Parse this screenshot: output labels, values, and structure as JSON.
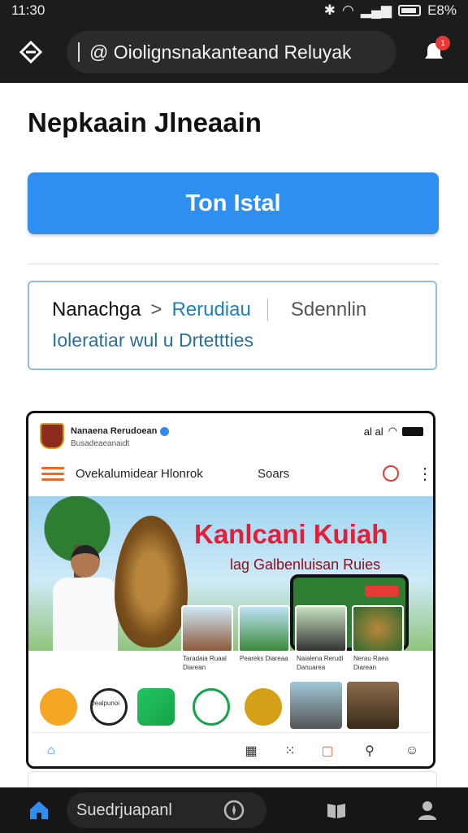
{
  "status": {
    "time": "11:30",
    "battery": "E8%"
  },
  "browser": {
    "url": "@ Oiolignsnakanteand Reluyak",
    "notification_count": "1"
  },
  "page": {
    "title": "Nepkaain Jlneaain",
    "install_label": "Ton Istal",
    "breadcrumb": {
      "home": "Nanachga",
      "separator": ">",
      "current": "Rerudiau",
      "extra": "Sdennlin",
      "subtitle": "Ioleratiar wul u Drtettties"
    }
  },
  "preview": {
    "account_name": "Nanaena Rerudoean",
    "account_sub": "Busadeaeanaidt",
    "status_signal": "al al",
    "nav_title": "Ovekalumidear Hlonrok",
    "nav_search": "Soars",
    "banner": {
      "title": "Kanlcani Kuiah",
      "subtitle": "lag Galbenluisan Ruies"
    },
    "thumb_captions": [
      "Taradaia Ruaal Diarean",
      "Peareks Diareaa",
      "Naialena Rerudl Danuarea",
      "Nerau Raea Diarean"
    ],
    "app_caption": "Dealpunoi",
    "tab_icons": [
      "home-icon",
      "store-icon",
      "apps-icon",
      "chat-icon",
      "search-icon",
      "profile-icon"
    ]
  },
  "bottom_nav": {
    "search_placeholder": "Suedrjuapanl"
  },
  "colors": {
    "accent": "#2f8ff0",
    "link": "#1f7fbf",
    "banner_title": "#e21f3a",
    "dark_bar": "#1c1c1c"
  }
}
